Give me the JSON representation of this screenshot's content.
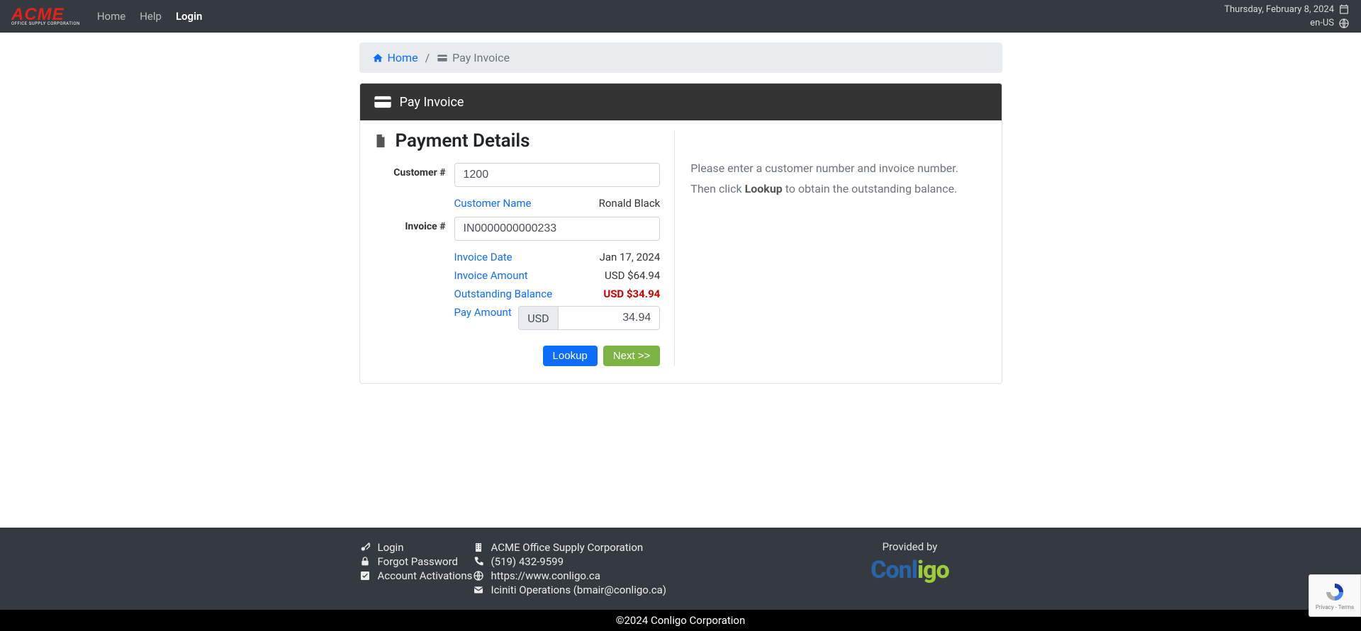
{
  "header": {
    "logo": {
      "main": "ACME",
      "sub": "OFFICE SUPPLY CORPORATION"
    },
    "nav": {
      "home": "Home",
      "help": "Help",
      "login": "Login"
    },
    "date": "Thursday, February 8, 2024",
    "locale": "en-US"
  },
  "breadcrumb": {
    "home": "Home",
    "current": "Pay Invoice"
  },
  "card": {
    "title": "Pay Invoice",
    "section_title": "Payment Details",
    "labels": {
      "customer_no": "Customer #",
      "invoice_no": "Invoice #"
    },
    "inputs": {
      "customer_no": "1200",
      "invoice_no": "IN0000000000233",
      "pay_amount": "34.94",
      "currency": "USD"
    },
    "details": {
      "customer_name": {
        "label": "Customer Name",
        "value": "Ronald Black"
      },
      "invoice_date": {
        "label": "Invoice Date",
        "value": "Jan 17, 2024"
      },
      "invoice_amount": {
        "label": "Invoice Amount",
        "value": "USD $64.94"
      },
      "outstanding": {
        "label": "Outstanding Balance",
        "value": "USD $34.94"
      },
      "pay_amount": {
        "label": "Pay Amount"
      }
    },
    "help": {
      "line1": "Please enter a customer number and invoice number.",
      "line2a": "Then click ",
      "line2b": "Lookup",
      "line2c": " to obtain the outstanding balance."
    },
    "buttons": {
      "lookup": "Lookup",
      "next": "Next >>"
    }
  },
  "footer": {
    "col1": {
      "login": "Login",
      "forgot": "Forgot Password",
      "activations": "Account Activations"
    },
    "col2": {
      "company": "ACME Office Supply Corporation",
      "phone": "(519) 432-9599",
      "url": "https://www.conligo.ca",
      "email_line": "Iciniti Operations (bmair@conligo.ca)"
    },
    "col3": {
      "provided": "Provided by",
      "brand": "Conligo"
    }
  },
  "subfooter": "©2024 Conligo Corporation",
  "recaptcha": {
    "privacy": "Privacy",
    "terms": "Terms"
  }
}
